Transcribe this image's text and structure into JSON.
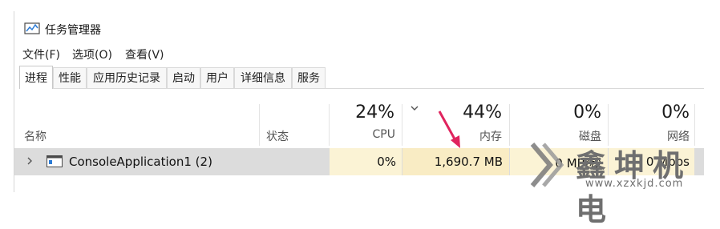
{
  "window": {
    "title": "任务管理器",
    "icon": "task-manager-icon"
  },
  "menu": [
    "文件(F)",
    "选项(O)",
    "查看(V)"
  ],
  "tabs": [
    {
      "label": "进程",
      "active": true
    },
    {
      "label": "性能",
      "active": false
    },
    {
      "label": "应用历史记录",
      "active": false
    },
    {
      "label": "启动",
      "active": false
    },
    {
      "label": "用户",
      "active": false
    },
    {
      "label": "详细信息",
      "active": false
    },
    {
      "label": "服务",
      "active": false
    }
  ],
  "columns": {
    "name": {
      "label": "名称"
    },
    "status": {
      "label": "状态"
    },
    "cpu": {
      "label": "CPU",
      "percent": "24%"
    },
    "memory": {
      "label": "内存",
      "percent": "44%"
    },
    "disk": {
      "label": "磁盘",
      "percent": "0%"
    },
    "network": {
      "label": "网络",
      "percent": "0%"
    }
  },
  "rows": [
    {
      "name": "ConsoleApplication1 (2)",
      "status": "",
      "cpu": "0%",
      "memory": "1,690.7 MB",
      "disk": "0 MB/秒",
      "network": "0 Mbps"
    }
  ],
  "colors": {
    "row_bg": "#dcdcdc",
    "highlight": "#fbf3d5",
    "annotation_arrow": "#e0245e"
  },
  "watermark": {
    "text": "鑫坤机电",
    "url": "www.xzxkjd.com"
  }
}
